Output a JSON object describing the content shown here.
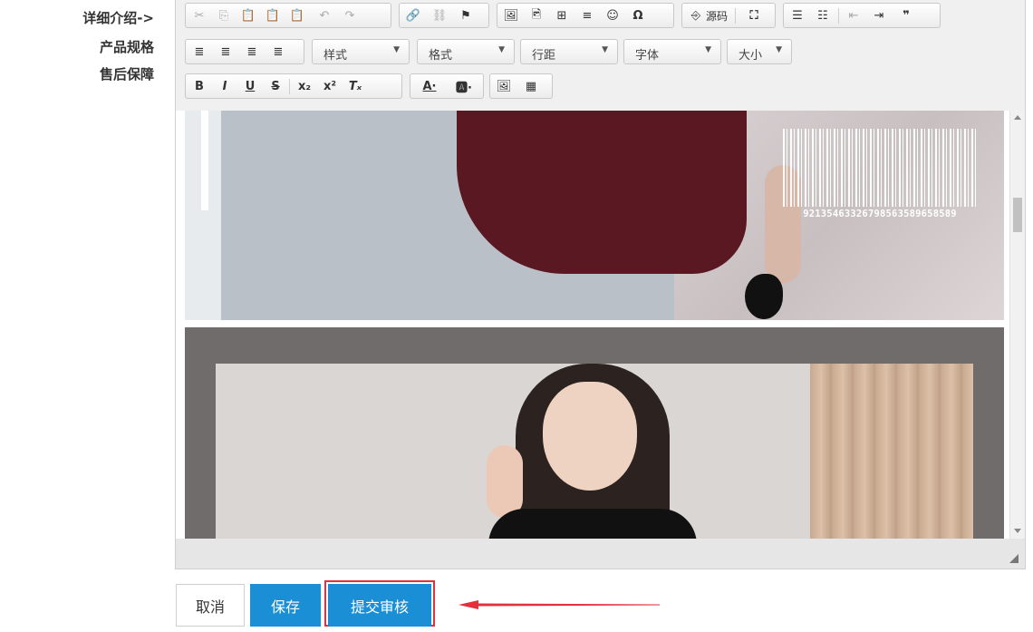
{
  "side_menu": {
    "items": [
      "详细介绍->",
      "产品规格",
      "售后保障"
    ]
  },
  "toolbar": {
    "row1_icons": [
      "cut-icon",
      "copy-icon",
      "paste-icon",
      "paste-text-icon",
      "paste-word-icon",
      "undo-icon",
      "redo-icon",
      "link-icon",
      "unlink-icon",
      "anchor-icon",
      "image-icon",
      "insert-image-icon",
      "table-icon",
      "horizontal-rule-icon",
      "smiley-icon",
      "special-char-icon",
      "source-icon",
      "maximize-icon",
      "numbered-list-icon",
      "bulleted-list-icon",
      "outdent-icon",
      "indent-icon",
      "blockquote-icon"
    ],
    "source_label": "源码",
    "row2_icons": [
      "align-left-icon",
      "align-center-icon",
      "align-right-icon",
      "justify-icon"
    ],
    "combos": [
      {
        "label": "样式"
      },
      {
        "label": "格式"
      },
      {
        "label": "行距"
      },
      {
        "label": "字体"
      },
      {
        "label": "大小"
      }
    ],
    "row3_icons": [
      "bold-icon",
      "italic-icon",
      "underline-icon",
      "strikethrough-icon",
      "subscript-icon",
      "superscript-icon",
      "remove-format-icon",
      "text-color-icon",
      "bg-color-icon",
      "image-upload-icon",
      "qrcode-icon"
    ]
  },
  "content": {
    "barcode_number": "92135463326798563589658589"
  },
  "buttons": {
    "cancel": "取消",
    "save": "保存",
    "submit": "提交审核"
  }
}
